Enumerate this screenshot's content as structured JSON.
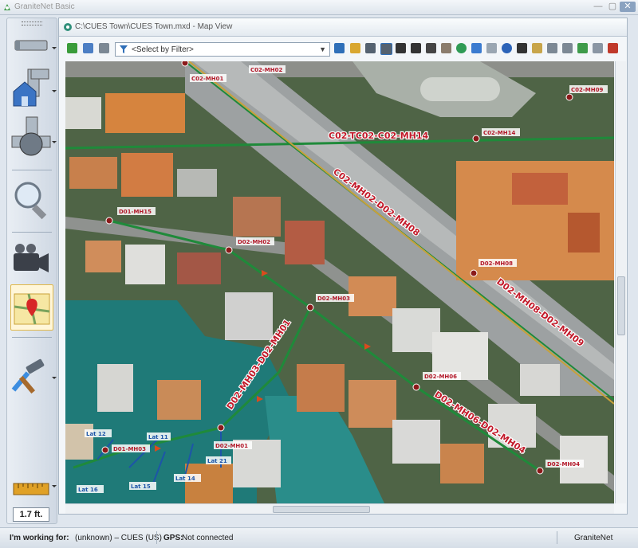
{
  "window": {
    "title": "GraniteNet Basic",
    "controls": [
      "—",
      "▢",
      "✕"
    ]
  },
  "doc_tab": {
    "title": "C:\\CUES Town\\CUES Town.mxd - Map View"
  },
  "toolbar": {
    "filter_placeholder": "<Select by Filter>"
  },
  "left_tools": {
    "measure_value": "1.7 ft."
  },
  "status": {
    "working_label": "I'm working for:",
    "working_value": "(unknown) – CUES (US)",
    "gps_label": "GPS:",
    "gps_value": "Not connected",
    "app_name": "GraniteNet"
  },
  "map": {
    "segment_labels": [
      "C02-TC02-C02-MH14",
      "C02-MH02-D02-MH08",
      "D02-MH08-D02-MH09",
      "D02-MH03-D02-MH01",
      "D02-MH06-D02-MH04"
    ],
    "manhole_labels": [
      "C02-MH01",
      "C02-MH02",
      "C02-MH09",
      "C02-MH14",
      "D01-MH15",
      "D02-MH02",
      "D02-MH08",
      "D02-MH03",
      "D02-MH06",
      "D02-MH01",
      "D01-MH03",
      "D02-MH04"
    ],
    "lateral_labels": [
      "Lat 12",
      "Lat 11",
      "Lat 21",
      "Lat 16",
      "Lat 15",
      "Lat 14"
    ]
  },
  "colors": {
    "pipe": "#1f8a3a",
    "label": "#c21a2a",
    "manhole": "#8b1a1a",
    "lateral": "#1d55a8"
  }
}
